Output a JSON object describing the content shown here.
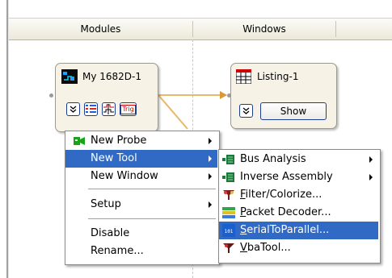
{
  "columns": {
    "modules": "Modules",
    "windows": "Windows"
  },
  "module_node": {
    "title": "My 1682D-1",
    "icon": "analyzer-icon",
    "tool_icons": [
      "tool-list-icon",
      "waveform-icon"
    ],
    "trig_label": "Trig"
  },
  "window_node": {
    "title": "Listing-1",
    "icon": "listing-icon",
    "show_label": "Show"
  },
  "context_menu": {
    "items": [
      {
        "label": "New Probe",
        "icon": "probe-icon",
        "submenu": true,
        "selected": false
      },
      {
        "label": "New Tool",
        "submenu": true,
        "selected": true
      },
      {
        "label": "New Window",
        "submenu": true,
        "selected": false
      },
      {
        "label": "Setup",
        "submenu": true,
        "selected": false
      },
      {
        "label": "Disable",
        "submenu": false,
        "selected": false
      },
      {
        "label": "Rename...",
        "submenu": false,
        "selected": false
      }
    ]
  },
  "tool_submenu": {
    "items": [
      {
        "label": "Bus Analysis",
        "icon": "bus-icon",
        "submenu": true,
        "selected": false
      },
      {
        "label": "Inverse Assembly",
        "icon": "bus-icon",
        "submenu": true,
        "selected": false
      },
      {
        "label": "Filter/Colorize...",
        "mnemonic": "F",
        "rest": "ilter/Colorize...",
        "icon": "filter-icon",
        "selected": false
      },
      {
        "label": "Packet Decoder...",
        "mnemonic": "P",
        "rest": "acket Decoder...",
        "icon": "packet-icon",
        "selected": false
      },
      {
        "label": "SerialToParallel...",
        "mnemonic": "S",
        "rest": "erialToParallel...",
        "icon": "serial-icon",
        "selected": true
      },
      {
        "label": "VbaTool...",
        "mnemonic": "V",
        "rest": "baTool...",
        "icon": "vba-icon",
        "selected": false
      }
    ]
  },
  "colors": {
    "selection": "#316ac5",
    "node_fill": "#f6f3e6",
    "wire": "#e8b86d",
    "button_border": "#1c3d8e"
  }
}
